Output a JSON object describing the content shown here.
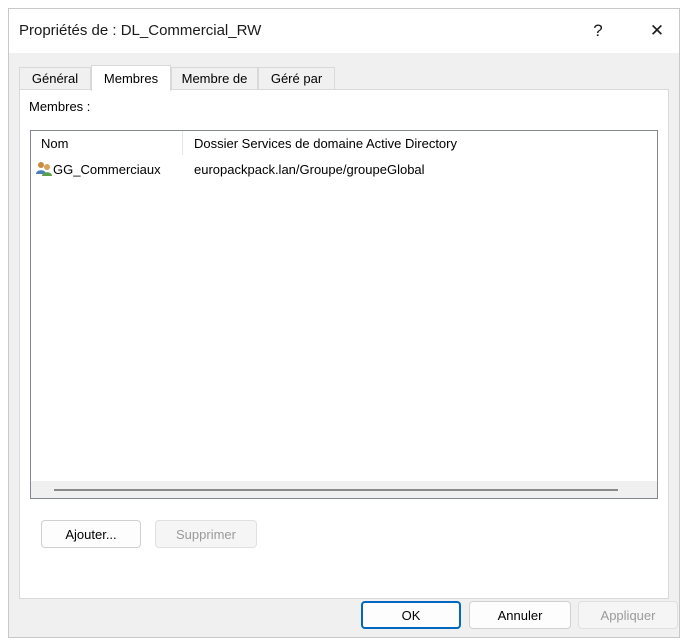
{
  "window": {
    "title": "Propriétés de : DL_Commercial_RW",
    "help_label": "?",
    "close_label": "✕"
  },
  "tabs": [
    {
      "label": "Général"
    },
    {
      "label": "Membres",
      "active": true
    },
    {
      "label": "Membre de"
    },
    {
      "label": "Géré par"
    }
  ],
  "members": {
    "section_label": "Membres :",
    "columns": [
      "Nom",
      "Dossier Services de domaine Active Directory"
    ],
    "rows": [
      {
        "name": "GG_Commerciaux",
        "folder": "europackpack.lan/Groupe/groupeGlobal",
        "icon": "group-icon"
      }
    ]
  },
  "buttons": {
    "add": "Ajouter...",
    "remove": "Supprimer",
    "ok": "OK",
    "cancel": "Annuler",
    "apply": "Appliquer"
  },
  "colors": {
    "accent": "#0067c0",
    "window_bg": "#f0f0f0"
  }
}
